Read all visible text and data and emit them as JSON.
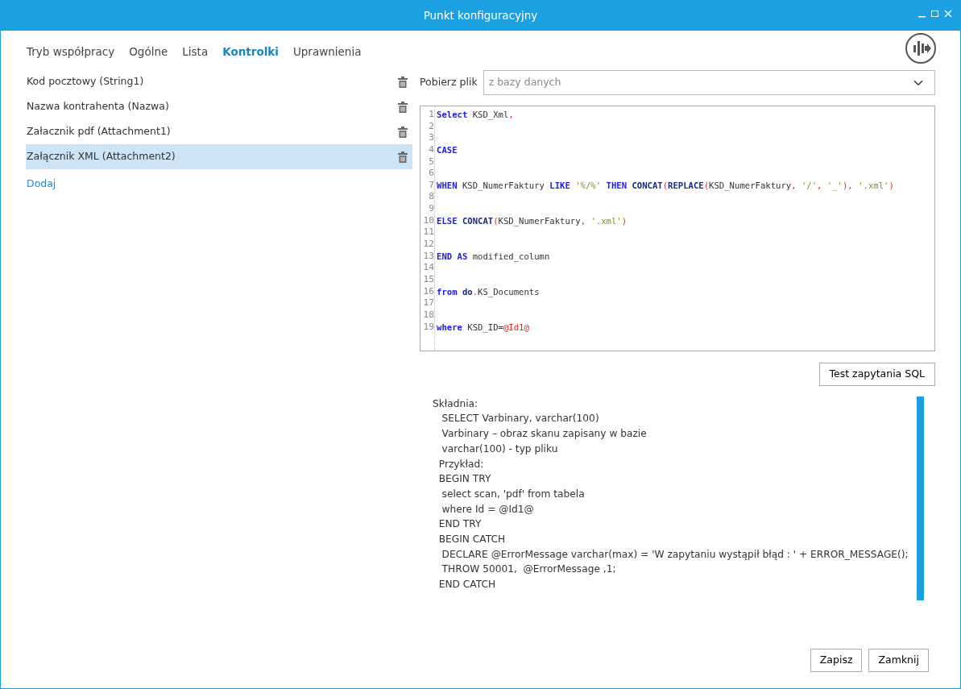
{
  "window": {
    "title": "Punkt konfiguracyjny"
  },
  "tabs": [
    {
      "label": "Tryb współpracy",
      "selected": false
    },
    {
      "label": "Ogólne",
      "selected": false
    },
    {
      "label": "Lista",
      "selected": false
    },
    {
      "label": "Kontrolki",
      "selected": true
    },
    {
      "label": "Uprawnienia",
      "selected": false
    }
  ],
  "controls": [
    {
      "label": "Kod pocztowy (String1)",
      "selected": false
    },
    {
      "label": "Nazwa kontrahenta (Nazwa)",
      "selected": false
    },
    {
      "label": "Załacznik pdf (Attachment1)",
      "selected": false
    },
    {
      "label": "Załącznik XML (Attachment2)",
      "selected": true
    }
  ],
  "add_link": "Dodaj",
  "source": {
    "label": "Pobierz plik",
    "value": "z bazy danych"
  },
  "editor": {
    "lines": [
      {
        "number": "1",
        "tokens": [
          {
            "kind": "keyword",
            "text": "Select"
          },
          {
            "kind": "plain",
            "text": " KSD_Xml"
          },
          {
            "kind": "punct",
            "text": ","
          }
        ]
      },
      {
        "number": "2"
      },
      {
        "number": "3"
      },
      {
        "number": "4",
        "tokens": [
          {
            "kind": "keyword",
            "text": "CASE"
          }
        ]
      },
      {
        "number": "5"
      },
      {
        "number": "6"
      },
      {
        "number": "7",
        "tokens": [
          {
            "kind": "keyword",
            "text": "WHEN"
          },
          {
            "kind": "plain",
            "text": " KSD_NumerFaktury "
          },
          {
            "kind": "keyword",
            "text": "LIKE "
          },
          {
            "kind": "string",
            "text": "'%/%' "
          },
          {
            "kind": "keyword",
            "text": "THEN "
          },
          {
            "kind": "function",
            "text": "CONCAT"
          },
          {
            "kind": "punct",
            "text": "("
          },
          {
            "kind": "function",
            "text": "REPLACE"
          },
          {
            "kind": "punct",
            "text": "("
          },
          {
            "kind": "plain",
            "text": "KSD_NumerFaktury"
          },
          {
            "kind": "punct",
            "text": ", "
          },
          {
            "kind": "string",
            "text": "'/'"
          },
          {
            "kind": "punct",
            "text": ", "
          },
          {
            "kind": "string",
            "text": "'_'"
          },
          {
            "kind": "punct",
            "text": "), "
          },
          {
            "kind": "string",
            "text": "'.xml'"
          },
          {
            "kind": "punct",
            "text": ")"
          }
        ]
      },
      {
        "number": "8"
      },
      {
        "number": "9"
      },
      {
        "number": "10",
        "tokens": [
          {
            "kind": "keyword",
            "text": "ELSE "
          },
          {
            "kind": "function",
            "text": "CONCAT"
          },
          {
            "kind": "punct",
            "text": "("
          },
          {
            "kind": "plain",
            "text": "KSD_NumerFaktury"
          },
          {
            "kind": "punct",
            "text": ", "
          },
          {
            "kind": "string",
            "text": "'.xml'"
          },
          {
            "kind": "punct",
            "text": ")"
          }
        ]
      },
      {
        "number": "11"
      },
      {
        "number": "12"
      },
      {
        "number": "13",
        "tokens": [
          {
            "kind": "keyword",
            "text": "END AS"
          },
          {
            "kind": "plain",
            "text": " modified_column"
          }
        ]
      },
      {
        "number": "14"
      },
      {
        "number": "15"
      },
      {
        "number": "16",
        "tokens": [
          {
            "kind": "keyword",
            "text": "from "
          },
          {
            "kind": "function",
            "text": "do"
          },
          {
            "kind": "punct",
            "text": "."
          },
          {
            "kind": "plain",
            "text": "KS_Documents"
          }
        ]
      },
      {
        "number": "17"
      },
      {
        "number": "18"
      },
      {
        "number": "19",
        "tokens": [
          {
            "kind": "keyword",
            "text": "where"
          },
          {
            "kind": "plain",
            "text": " KSD_ID="
          },
          {
            "kind": "variable",
            "text": "@Id1@"
          }
        ]
      }
    ]
  },
  "test_button": "Test zapytania SQL",
  "help_lines": [
    "Składnia:",
    "   SELECT Varbinary, varchar(100)",
    "   Varbinary – obraz skanu zapisany w bazie",
    "   varchar(100) - typ pliku",
    "  Przykład:",
    "  BEGIN TRY",
    "   select scan, 'pdf' from tabela",
    "   where Id = @Id1@",
    "  END TRY",
    "  BEGIN CATCH",
    "   DECLARE @ErrorMessage varchar(max) = 'W zapytaniu wystąpił błąd : ' + ERROR_MESSAGE();",
    "   THROW 50001,  @ErrorMessage ,1;",
    "  END CATCH"
  ],
  "buttons": [
    "Zapisz",
    "Zamknij"
  ]
}
